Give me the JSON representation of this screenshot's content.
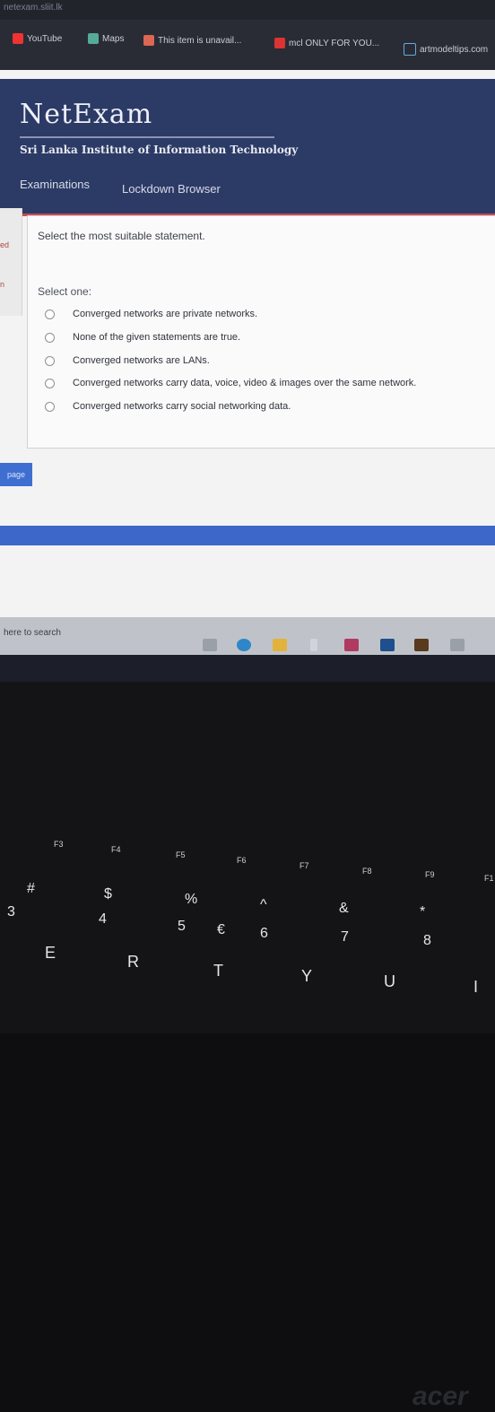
{
  "browser": {
    "url": "netexam.sliit.lk",
    "bookmarks": [
      {
        "label": "YouTube",
        "icon": "youtube-icon",
        "color": "#e33"
      },
      {
        "label": "Maps",
        "icon": "maps-icon",
        "color": "#5a9"
      },
      {
        "label": "This item is unavail...",
        "icon": "document-icon",
        "color": "#d65"
      },
      {
        "label": "mcl ONLY FOR YOU...",
        "icon": "bookmark-n-icon",
        "color": "#d33"
      },
      {
        "label": "artmodeltips.com",
        "icon": "page-icon",
        "color": "#6ad"
      }
    ]
  },
  "header": {
    "logo": "NetExam",
    "institute": "Sri Lanka Institute of Information Technology",
    "menu": [
      "Examinations",
      "Lockdown Browser"
    ]
  },
  "side": {
    "label_1": "ed",
    "label_2": "n",
    "page_button": "page"
  },
  "question": {
    "text": "Select the most suitable statement.",
    "select_one": "Select one:",
    "options": [
      "Converged networks are private networks.",
      "None of the given statements are true.",
      "Converged networks are LANs.",
      "Converged networks carry data, voice, video & images over the same network.",
      "Converged networks carry social networking data."
    ]
  },
  "taskbar": {
    "search_placeholder": "here to search",
    "icons": [
      "task-view-icon",
      "edge-icon",
      "file-explorer-icon",
      "pen-icon",
      "indesign-icon",
      "photoshop-icon",
      "illustrator-icon",
      "calendar-icon"
    ]
  },
  "keyboard": {
    "brand": "acer",
    "function_keys": [
      "F3",
      "F4",
      "F5",
      "F6",
      "F7",
      "F8",
      "F9",
      "F1"
    ],
    "symbol_keys": [
      "#",
      "$",
      "%",
      "^",
      "&",
      "*"
    ],
    "number_keys": [
      "3",
      "4",
      "5",
      "€",
      "6",
      "7",
      "8"
    ],
    "letter_keys": [
      "E",
      "R",
      "T",
      "Y",
      "U",
      "I"
    ]
  }
}
